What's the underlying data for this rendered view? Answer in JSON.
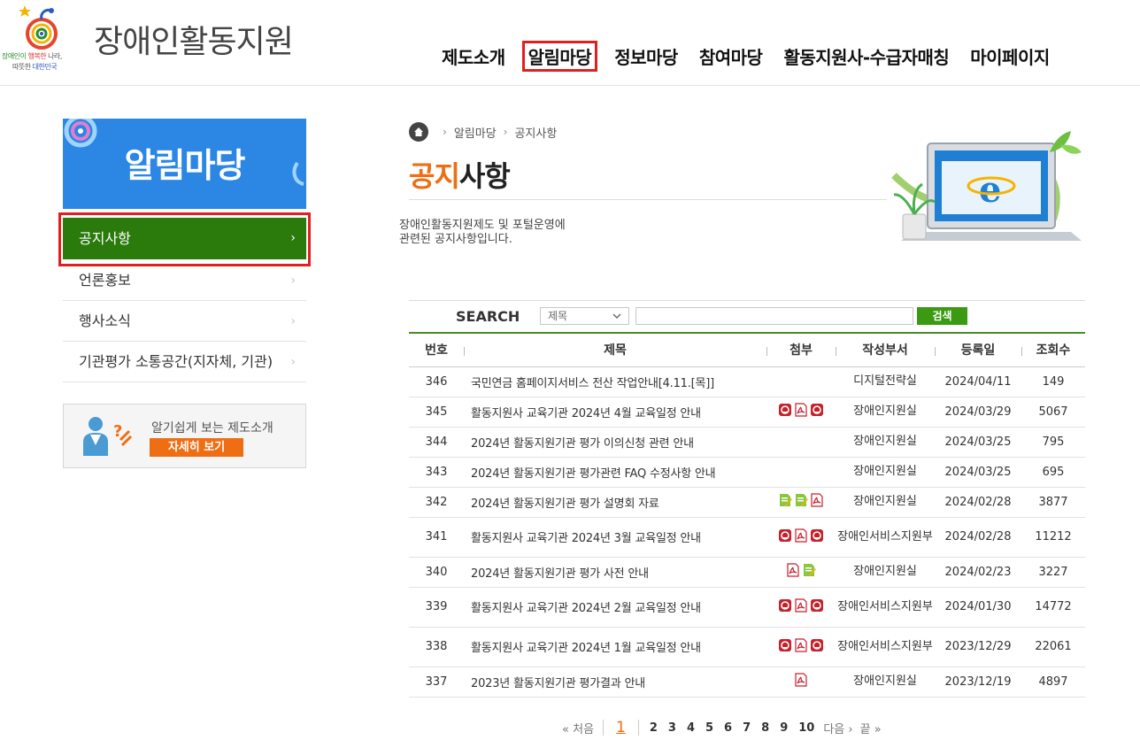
{
  "header": {
    "site_title": "장애인활동지원",
    "slogan_line1_part1": "장애인이",
    "slogan_line1_part2": "행복한",
    "slogan_line1_part3": "나라,",
    "slogan_line2_part1": "따뜻한",
    "slogan_line2_part2": "대한민국",
    "nav": [
      {
        "label": "제도소개",
        "active": false
      },
      {
        "label": "알림마당",
        "active": true
      },
      {
        "label": "정보마당",
        "active": false
      },
      {
        "label": "참여마당",
        "active": false
      },
      {
        "label": "활동지원사-수급자매칭",
        "active": false
      },
      {
        "label": "마이페이지",
        "active": false
      }
    ]
  },
  "sidebar": {
    "banner_title": "알림마당",
    "items": [
      {
        "label": "공지사항",
        "active": true
      },
      {
        "label": "언론홍보",
        "active": false
      },
      {
        "label": "행사소식",
        "active": false
      },
      {
        "label": "기관평가 소통공간(지자체, 기관)",
        "active": false
      }
    ],
    "chevron": "›",
    "guide_text": "알기쉽게 보는 제도소개",
    "guide_button": "자세히 보기"
  },
  "breadcrumb": {
    "items": [
      "알림마당",
      "공지사항"
    ],
    "sep": "›"
  },
  "page": {
    "title_highlight": "공지",
    "title_rest": "사항",
    "desc_line1": "장애인활동지원제도 및 포털운영에",
    "desc_line2": "관련된 공지사항입니다."
  },
  "search": {
    "label": "SEARCH",
    "select_value": "제목",
    "input_value": "",
    "button": "검색"
  },
  "table": {
    "headers": {
      "no": "번호",
      "title": "제목",
      "attach": "첨부",
      "dept": "작성부서",
      "date": "등록일",
      "views": "조회수"
    },
    "rows": [
      {
        "no": "346",
        "title": "국민연금 홈페이지서비스 전산 작업안내[4.11.[목]]",
        "attach": [],
        "dept": "디지털전략실",
        "date": "2024/04/11",
        "views": "149"
      },
      {
        "no": "345",
        "title": "활동지원사 교육기관 2024년 4월 교육일정 안내",
        "attach": [
          "hwp",
          "pdf",
          "hwp"
        ],
        "dept": "장애인지원실",
        "date": "2024/03/29",
        "views": "5067"
      },
      {
        "no": "344",
        "title": "2024년 활동지원기관 평가 이의신청 관련 안내",
        "attach": [],
        "dept": "장애인지원실",
        "date": "2024/03/25",
        "views": "795"
      },
      {
        "no": "343",
        "title": "2024년 활동지원기관 평가관련 FAQ 수정사항 안내",
        "attach": [],
        "dept": "장애인지원실",
        "date": "2024/03/25",
        "views": "695"
      },
      {
        "no": "342",
        "title": "2024년 활동지원기관 평가 설명회 자료",
        "attach": [
          "doc",
          "doc",
          "pdf"
        ],
        "dept": "장애인지원실",
        "date": "2024/02/28",
        "views": "3877"
      },
      {
        "no": "341",
        "title": "활동지원사 교육기관 2024년 3월 교육일정 안내",
        "attach": [
          "hwp",
          "pdf",
          "hwp"
        ],
        "dept": "장애인서비스지원부",
        "date": "2024/02/28",
        "views": "11212"
      },
      {
        "no": "340",
        "title": "2024년 활동지원기관 평가 사전 안내",
        "attach": [
          "pdf",
          "doc"
        ],
        "dept": "장애인지원실",
        "date": "2024/02/23",
        "views": "3227"
      },
      {
        "no": "339",
        "title": "활동지원사 교육기관 2024년 2월 교육일정 안내",
        "attach": [
          "hwp",
          "pdf",
          "hwp"
        ],
        "dept": "장애인서비스지원부",
        "date": "2024/01/30",
        "views": "14772"
      },
      {
        "no": "338",
        "title": "활동지원사 교육기관 2024년 1월 교육일정 안내",
        "attach": [
          "hwp",
          "pdf",
          "hwp"
        ],
        "dept": "장애인서비스지원부",
        "date": "2023/12/29",
        "views": "22061"
      },
      {
        "no": "337",
        "title": "2023년 활동지원기관 평가결과 안내",
        "attach": [
          "pdf"
        ],
        "dept": "장애인지원실",
        "date": "2023/12/19",
        "views": "4897"
      }
    ]
  },
  "pagination": {
    "first": "처음",
    "first_arrow": "«",
    "current": "1",
    "pages": [
      "2",
      "3",
      "4",
      "5",
      "6",
      "7",
      "8",
      "9",
      "10"
    ],
    "next": "다음",
    "next_arrow": "›",
    "last": "끝",
    "last_arrow": "»"
  },
  "colors": {
    "accent_orange": "#ef6d13",
    "sidebar_active": "#2a7a0c",
    "search_button": "#3a9a12",
    "banner_blue": "#2b87e3",
    "highlight_frame": "#e02020"
  }
}
